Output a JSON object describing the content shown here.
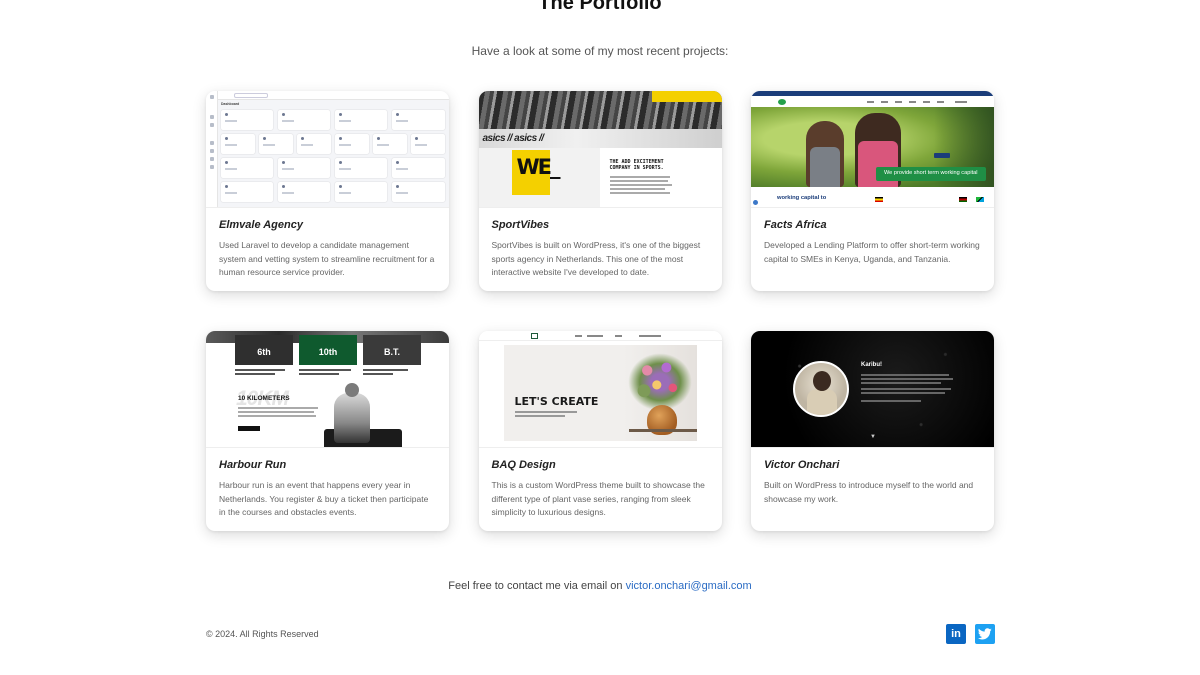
{
  "header": {
    "title": "The Portfolio",
    "subtitle": "Have a look at some of my most recent projects:"
  },
  "projects": [
    {
      "title": "Elmvale Agency",
      "description": "Used Laravel to develop a candidate management system and vetting system to streamline recruitment for a human resource service provider.",
      "thumb_text": "Dashboard"
    },
    {
      "title": "SportVibes",
      "description": "SportVibes is built on WordPress, it's one of the biggest sports agency in Netherlands. This one of the most interactive website I've developed to date.",
      "thumb_logo": "WE_",
      "thumb_heading": "THE ADD EXCITEMENT COMPANY IN SPORTS.",
      "thumb_banner": "asics // asics //"
    },
    {
      "title": "Facts Africa",
      "description": "Developed a Lending Platform to offer short-term working capital to SMEs in Kenya, Uganda, and Tanzania.",
      "thumb_tag": "We provide short term working capital",
      "thumb_bottom": "working capital to"
    },
    {
      "title": "Harbour Run",
      "description": "Harbour run is an event that happens every year in Netherlands. You register & buy a ticket then participate in the courses and obstacles events.",
      "thumb_tiles": [
        "6th",
        "10th",
        "B.T."
      ],
      "thumb_km": "10 KILOMETERS",
      "thumb_km_big": "10KM"
    },
    {
      "title": "BAQ Design",
      "description": "This is a custom WordPress theme built to showcase the different type of plant vase series, ranging from sleek simplicity to luxurious designs.",
      "thumb_heading": "LET'S CREATE"
    },
    {
      "title": "Victor Onchari",
      "description": "Built on WordPress to introduce myself to the world and showcase my work.",
      "thumb_hello": "Karibu!"
    }
  ],
  "contact": {
    "text": "Feel free to contact me via email on ",
    "email": "victor.onchari@gmail.com"
  },
  "footer": {
    "copyright": "© 2024. All Rights Reserved",
    "linkedin_label": "in"
  },
  "colors": {
    "link": "#2b6cc4",
    "linkedin": "#0a66c2",
    "twitter": "#1da1f2"
  },
  "icons": {
    "linkedin": "linkedin-icon",
    "twitter": "twitter-icon"
  }
}
